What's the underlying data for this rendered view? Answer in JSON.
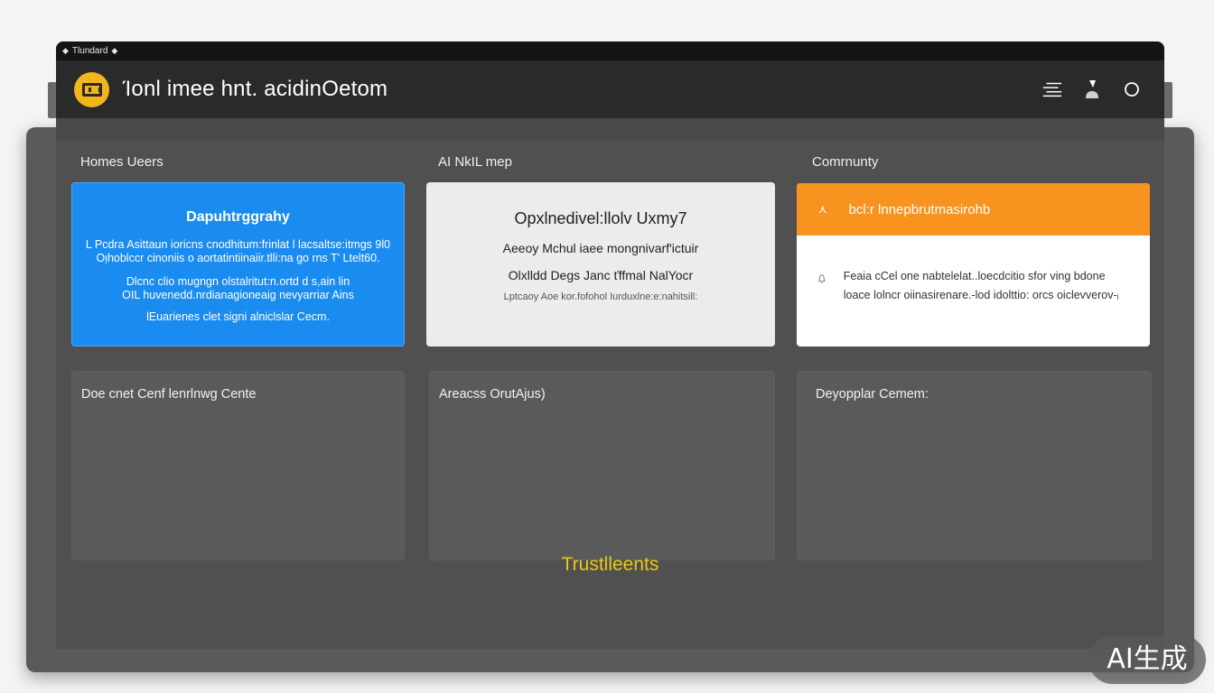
{
  "statusbar": {
    "text": "Tlundard"
  },
  "header": {
    "title": "Ίοnl imee hnt. acidinOetom"
  },
  "columns": {
    "left_label": "Homes Ueers",
    "middle_label": "AI NkIL mep",
    "right_label": "Comrnunty"
  },
  "card_blue": {
    "title": "Dapuhtrggrahy",
    "lines": [
      "L Pcdra Asittaun ioricns cnodhitum:frinlat l lacsaltse:itmgs 9l0",
      "Oᴉhoblccr  cinoniis o aortatintiinaiir.tlli:na go  rns  T' Ltelt60.",
      "Dlcnc clio  mugngn  olstalritut:n.ortd  d  s,ain  lin",
      "OIL  huvenedd.nrdianagioneaig  nevyarriar Ains",
      "lEuarienes clet  signi alniclslar  Cecm."
    ]
  },
  "card_white": {
    "title": "Opxlnedivel:llolv Uxmy7",
    "line1": "Aeeoy Mchul iaee mongnivarf'ictuir",
    "line2": "Olxlldd Degs  Janc  ťffmal NalYocr",
    "small": "Lptcaoy  Aoe kor.fofohol  Iurduxlne:e:nahitsill:"
  },
  "card_orange": {
    "header": "bcl:r lnnepbrutmasirohb",
    "body": "Feaia cCel one nabtelelat..loecdcitio sfor ving bdone loace lolncr oiinasirenare.-lod idolttio: orcs oiclevverov-ᵢ"
  },
  "panels": [
    {
      "title": "Doe cnet Cenf lenrlnwg Cente"
    },
    {
      "title": "Areacss OrutAjus)"
    },
    {
      "title": "Deyopplar Cemem:"
    }
  ],
  "footer": {
    "text": "Trustlleents"
  },
  "watermark": {
    "text": "AI生成"
  },
  "colors": {
    "accent_yellow": "#f2b51c",
    "blue_card": "#1a8cf0",
    "orange_header": "#f7931e",
    "footer_text": "#e6c814"
  }
}
